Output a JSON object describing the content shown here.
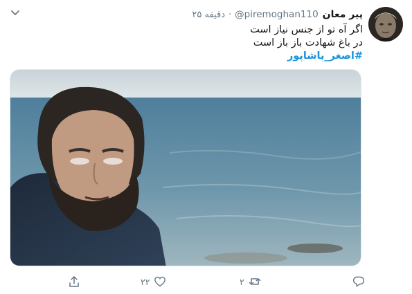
{
  "tweet": {
    "author_name": "پیر معان",
    "handle": "@piremoghan110",
    "separator": "·",
    "time": "۲۵ دقیقه",
    "lines": [
      "اگر آه تو از جنس نیاز است",
      "در باغ شهادت باز باز است"
    ],
    "hashtag": "#اصغر_پاشاپور"
  },
  "actions": {
    "reply_count": "",
    "retweet_count": "۲",
    "like_count": "۲۲"
  },
  "icons": {
    "menu": "chevron-down-icon",
    "reply": "reply-icon",
    "retweet": "retweet-icon",
    "like": "heart-icon",
    "share": "share-icon"
  },
  "colors": {
    "text": "#14171a",
    "muted": "#657786",
    "link": "#1b95e0",
    "border": "#e1e8ed"
  }
}
